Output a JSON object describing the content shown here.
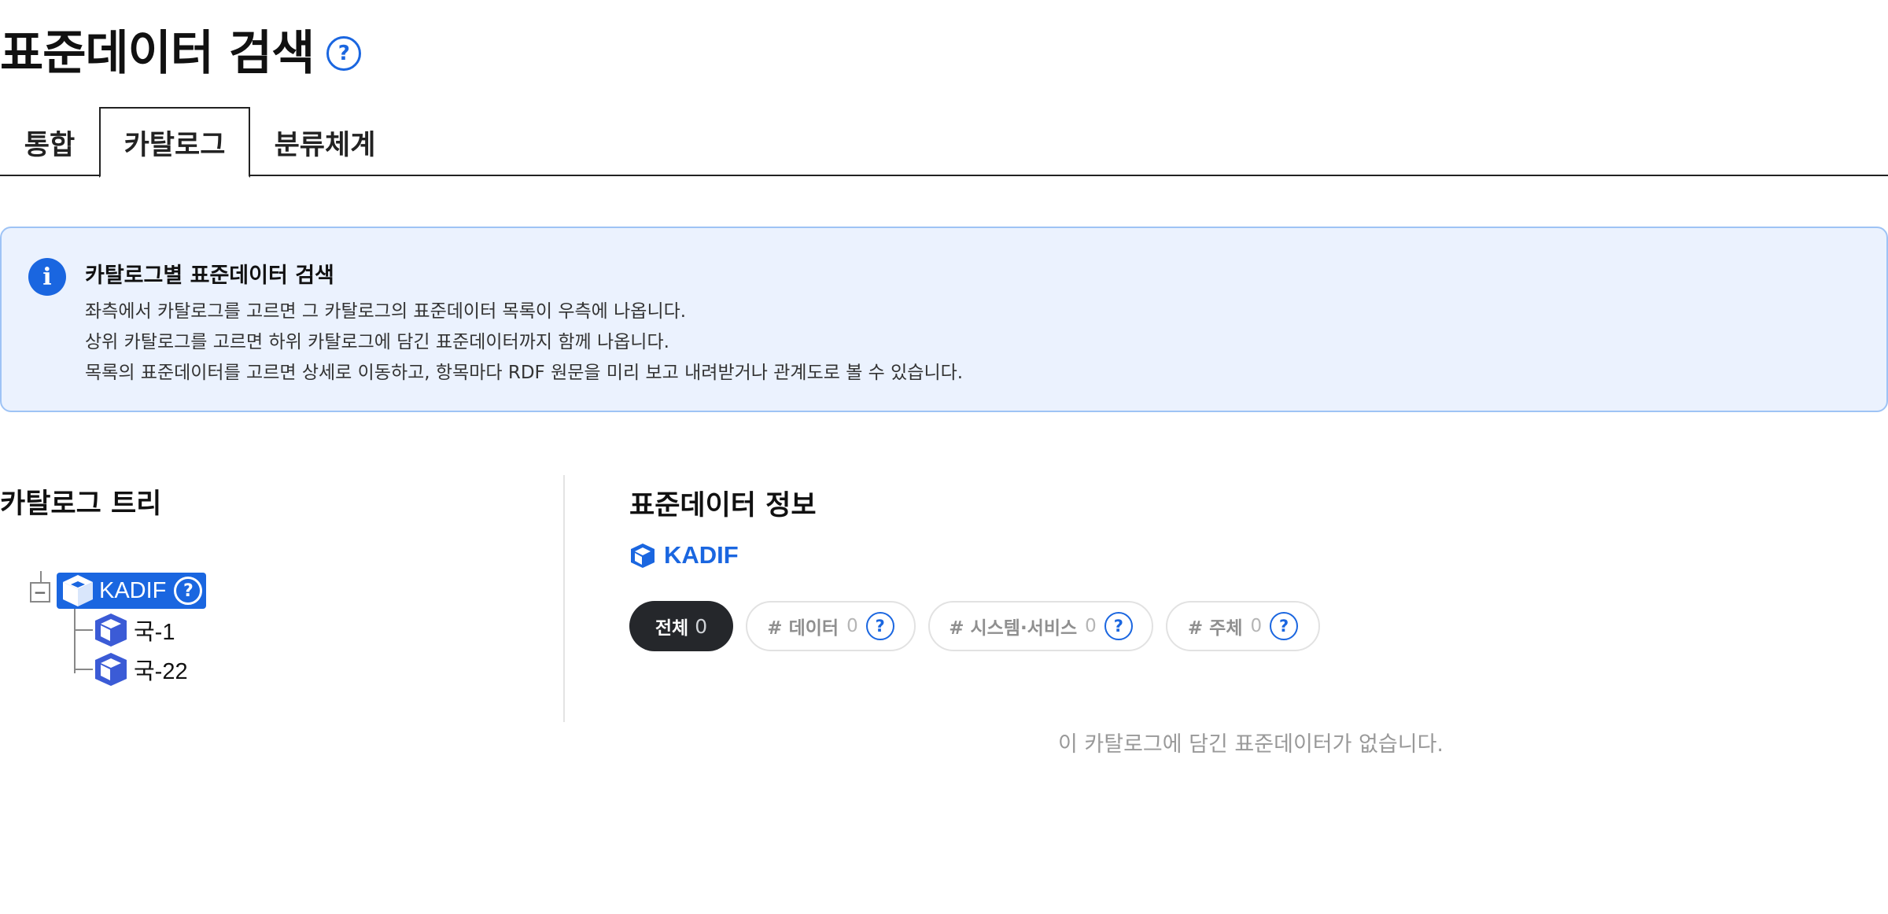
{
  "page": {
    "title": "표준데이터 검색",
    "help": "?"
  },
  "tabs": [
    {
      "label": "통합",
      "active": false
    },
    {
      "label": "카탈로그",
      "active": true
    },
    {
      "label": "분류체계",
      "active": false
    }
  ],
  "info": {
    "icon": "i",
    "title": "카탈로그별 표준데이터 검색",
    "lines": [
      "좌측에서 카탈로그를 고르면 그 카탈로그의 표준데이터 목록이 우측에 나옵니다.",
      "상위 카탈로그를 고르면 하위 카탈로그에 담긴 표준데이터까지 함께 나옵니다.",
      "목록의 표준데이터를 고르면 상세로 이동하고, 항목마다 RDF 원문을 미리 보고 내려받거나 관계도로 볼 수 있습니다."
    ]
  },
  "tree": {
    "title": "카탈로그 트리",
    "collapse_symbol": "−",
    "root": {
      "label": "KADIF",
      "help": "?",
      "icon": "cube-icon"
    },
    "children": [
      {
        "label": "국-1",
        "icon": "cube-icon"
      },
      {
        "label": "국-22",
        "icon": "cube-icon"
      }
    ]
  },
  "detail": {
    "title": "표준데이터 정보",
    "catalog": "KADIF",
    "filters": [
      {
        "label": "전체",
        "count": "0",
        "active": true
      },
      {
        "label": "# 데이터",
        "count": "0",
        "help": "?"
      },
      {
        "label": "# 시스템·서비스",
        "count": "0",
        "help": "?"
      },
      {
        "label": "# 주체",
        "count": "0",
        "help": "?"
      }
    ],
    "empty_message": "이 카탈로그에 담긴 표준데이터가 없습니다."
  },
  "colors": {
    "accent": "#1a66e0",
    "info_bg": "#ebf2fe",
    "info_border": "#9ec3f5",
    "pill_active": "#25272b"
  }
}
